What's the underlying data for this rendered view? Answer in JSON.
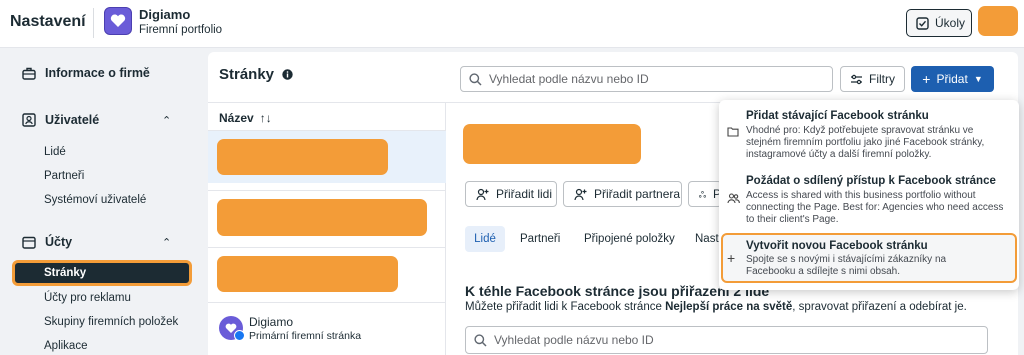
{
  "header": {
    "app_title": "Nastavení",
    "org_name": "Digiamo",
    "org_subtitle": "Firemní portfolio",
    "tasks_label": "Úkoly",
    "colors": {
      "accent_orange": "#f39c38",
      "brand_blue": "#1d5fb0",
      "logo_purple": "#6a5cd8"
    }
  },
  "sidebar": {
    "company_info": "Informace o firmě",
    "users_group": "Uživatelé",
    "users_items": [
      "Lidé",
      "Partneři",
      "Systémoví uživatelé"
    ],
    "accounts_group": "Účty",
    "accounts_items": [
      "Stránky",
      "Účty pro reklamu",
      "Skupiny firemních položek",
      "Aplikace"
    ],
    "active_item": "Stránky"
  },
  "main": {
    "title": "Stránky",
    "search_placeholder": "Vyhledat podle názvu nebo ID",
    "filter_label": "Filtry",
    "add_label": "Přidat"
  },
  "list": {
    "column_header": "Název",
    "sort_icon": "↑↓",
    "page_item": {
      "name": "Digiamo",
      "subtitle": "Primární firemní stránka"
    }
  },
  "detail": {
    "actions": [
      "Přiřadit lidi",
      "Přiřadit partnera",
      "P"
    ],
    "tabs": [
      "Lidé",
      "Partneři",
      "Připojené položky",
      "Nasta"
    ],
    "section_title": "K téhle Facebook stránce jsou přiřazeni 2 lidé",
    "section_desc_prefix": "Můžete přiřadit lidi k Facebook stránce ",
    "section_desc_bold": "Nejlepší práce na světě",
    "section_desc_suffix": ", spravovat přiřazení a odebírat je.",
    "search_placeholder": "Vyhledat podle názvu nebo ID"
  },
  "dropdown": {
    "items": [
      {
        "icon": "folder-icon",
        "title": "Přidat stávající Facebook stránku",
        "desc": "Vhodné pro: Když potřebujete spravovat stránku ve stejném firemním portfoliu jako jiné Facebook stránky, instagramové účty a další firemní položky."
      },
      {
        "icon": "people-icon",
        "title": "Požádat o sdílený přístup k Facebook stránce",
        "desc": "Access is shared with this business portfolio without connecting the Page. Best for: Agencies who need access to their client's Page."
      },
      {
        "icon": "plus-icon",
        "title": "Vytvořit novou Facebook stránku",
        "desc": "Spojte se s novými i stávajícími zákazníky na Facebooku a sdílejte s nimi obsah."
      }
    ]
  }
}
